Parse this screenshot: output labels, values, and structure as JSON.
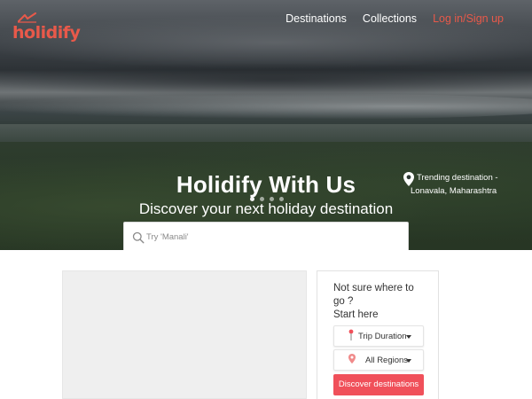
{
  "brand": {
    "name": "holidify",
    "accent": "#e8594a"
  },
  "nav": {
    "items": [
      "Destinations",
      "Collections"
    ],
    "login_label": "Log in/Sign up"
  },
  "hero": {
    "title": "Holidify With Us",
    "subtitle": "Discover your next holiday destination",
    "trending_line1": "Trending destination -",
    "trending_line2": "Lonavala, Maharashtra",
    "slide_count": 4,
    "active_slide": 1
  },
  "search": {
    "placeholder": "Try 'Manali'",
    "value": ""
  },
  "panel": {
    "heading_line1": "Not sure where to",
    "heading_line2": "go ?",
    "heading_line3": "Start here",
    "trip_duration_label": "Trip Duration",
    "regions_label": "All Regions",
    "discover_label": "Discover destinations",
    "discover_color": "#f0505a"
  },
  "icons": {
    "search": "search-icon",
    "trending_pin": "map-pin-icon",
    "duration": "pushpin-icon",
    "regions": "location-marker-icon"
  }
}
